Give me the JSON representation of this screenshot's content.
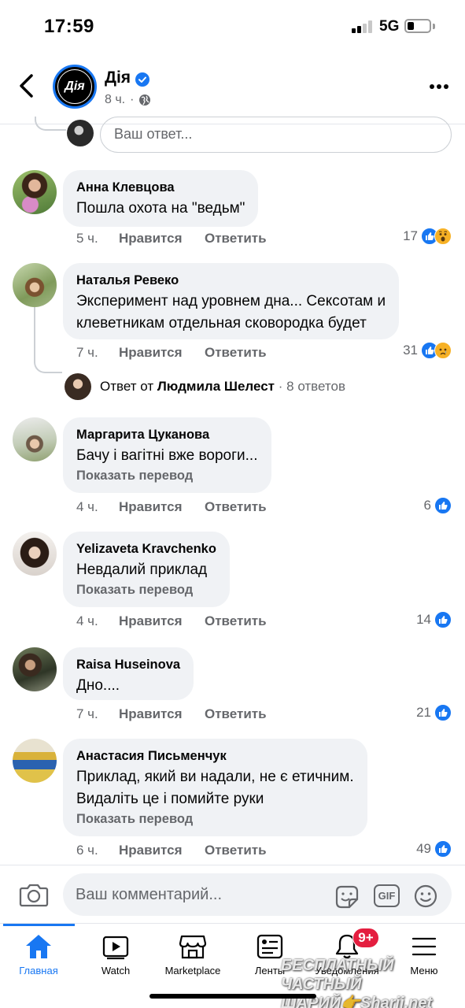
{
  "status": {
    "time": "17:59",
    "network": "5G"
  },
  "header": {
    "page_name": "Дія",
    "page_logo": "Дія",
    "meta_time": "8 ч.",
    "verified": true
  },
  "reply_box": {
    "placeholder": "Ваш ответ..."
  },
  "comments": [
    {
      "author": "Анна Клевцова",
      "text": "Пошла охота на \"ведьм\"",
      "time": "5 ч.",
      "like": "Нравится",
      "reply": "Ответить",
      "reactions": "17",
      "reaction_icons": [
        "like-icon",
        "wow-icon"
      ]
    },
    {
      "author": "Наталья Ревеко",
      "text": "Эксперимент над уровнем дна... Сексотам и\nклеветникам отдельная сковородка будет",
      "time": "7 ч.",
      "like": "Нравится",
      "reply": "Ответить",
      "reactions": "31",
      "reaction_icons": [
        "like-icon",
        "sad-icon"
      ],
      "replies": {
        "prefix": "Ответ от",
        "author": "Людмила Шелест",
        "separator": "·",
        "count": "8 ответов"
      }
    },
    {
      "author": "Маргарита Цуканова",
      "text": "Бачу і вагітні вже вороги...",
      "translate": "Показать перевод",
      "time": "4 ч.",
      "like": "Нравится",
      "reply": "Ответить",
      "reactions": "6",
      "reaction_icons": [
        "like-icon"
      ]
    },
    {
      "author": "Yelizaveta Kravchenko",
      "text": "Невдалий приклад",
      "translate": "Показать перевод",
      "time": "4 ч.",
      "like": "Нравится",
      "reply": "Ответить",
      "reactions": "14",
      "reaction_icons": [
        "like-icon"
      ]
    },
    {
      "author": "Raisa Huseinova",
      "text": "Дно....",
      "time": "7 ч.",
      "like": "Нравится",
      "reply": "Ответить",
      "reactions": "21",
      "reaction_icons": [
        "like-icon"
      ]
    },
    {
      "author": "Анастасия Письменчук",
      "text": "Приклад, який ви надали, не є етичним.\nВидаліть це і помийте руки",
      "translate": "Показать перевод",
      "time": "6 ч.",
      "like": "Нравится",
      "reply": "Ответить",
      "reactions": "49",
      "reaction_icons": [
        "like-icon"
      ]
    }
  ],
  "composer": {
    "placeholder": "Ваш комментарий...",
    "gif_label": "GIF"
  },
  "tabs": [
    {
      "label": "Главная",
      "icon": "home-icon",
      "active": true
    },
    {
      "label": "Watch",
      "icon": "watch-icon"
    },
    {
      "label": "Marketplace",
      "icon": "marketplace-icon"
    },
    {
      "label": "Ленты",
      "icon": "feeds-icon"
    },
    {
      "label": "Уведомления",
      "icon": "bell-icon"
    },
    {
      "label": "Меню",
      "icon": "menu-icon"
    }
  ],
  "notifications_badge": "9+",
  "watermark": {
    "line1": "БЕСПЛАТНЫЙ ЧАСТНЫЙ",
    "line2": "ШАРИЙ👉Sharij.net"
  },
  "colors": {
    "accent": "#1877f2",
    "bubble": "#f0f2f5",
    "muted": "#65676b",
    "badge": "#e41e3f"
  }
}
